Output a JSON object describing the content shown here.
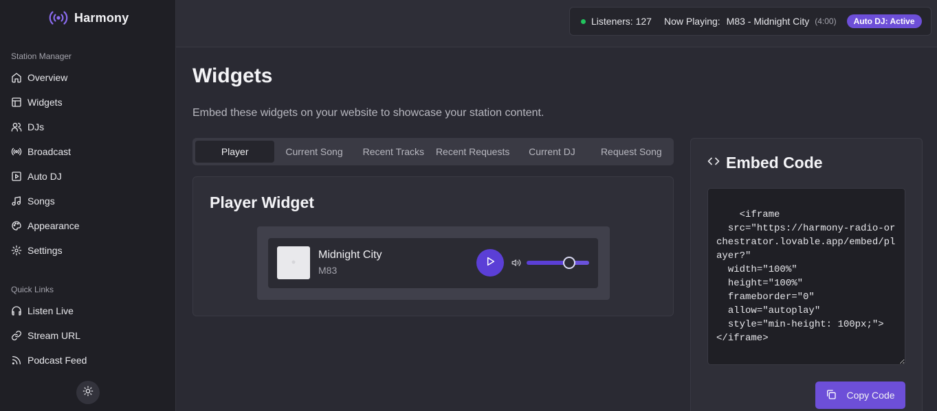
{
  "app": {
    "name": "Harmony"
  },
  "sidebar": {
    "section_station": "Station Manager",
    "station_items": [
      {
        "label": "Overview",
        "icon": "home-icon"
      },
      {
        "label": "Widgets",
        "icon": "layout-icon"
      },
      {
        "label": "DJs",
        "icon": "users-icon"
      },
      {
        "label": "Broadcast",
        "icon": "broadcast-icon"
      },
      {
        "label": "Auto DJ",
        "icon": "play-square-icon"
      },
      {
        "label": "Songs",
        "icon": "music-note-icon"
      },
      {
        "label": "Appearance",
        "icon": "palette-icon"
      },
      {
        "label": "Settings",
        "icon": "gear-icon"
      }
    ],
    "section_quick": "Quick Links",
    "quick_items": [
      {
        "label": "Listen Live",
        "icon": "headphones-icon"
      },
      {
        "label": "Stream URL",
        "icon": "link-icon"
      },
      {
        "label": "Podcast Feed",
        "icon": "rss-icon"
      }
    ]
  },
  "topbar": {
    "listeners_label": "Listeners: 127",
    "now_playing_label": "Now Playing:",
    "now_playing_track": "M83 - Midnight City",
    "duration": "(4:00)",
    "auto_dj_badge": "Auto DJ: Active",
    "status_color": "#22c55e",
    "accent": "#6d4fd8"
  },
  "main": {
    "title": "Widgets",
    "description": "Embed these widgets on your website to showcase your station content.",
    "tabs": [
      {
        "label": "Player",
        "active": true
      },
      {
        "label": "Current Song",
        "active": false
      },
      {
        "label": "Recent Tracks",
        "active": false
      },
      {
        "label": "Recent Requests",
        "active": false
      },
      {
        "label": "Current DJ",
        "active": false
      },
      {
        "label": "Request Song",
        "active": false
      }
    ],
    "widget_title": "Player Widget",
    "player": {
      "track_title": "Midnight City",
      "artist": "M83",
      "volume": 0.68
    }
  },
  "embed": {
    "title": "Embed Code",
    "code": "<iframe\n  src=\"https://harmony-radio-orchestrator.lovable.app/embed/player?\"\n  width=\"100%\"\n  height=\"100%\"\n  frameborder=\"0\"\n  allow=\"autoplay\"\n  style=\"min-height: 100px;\">\n</iframe>",
    "copy_label": "Copy Code"
  }
}
